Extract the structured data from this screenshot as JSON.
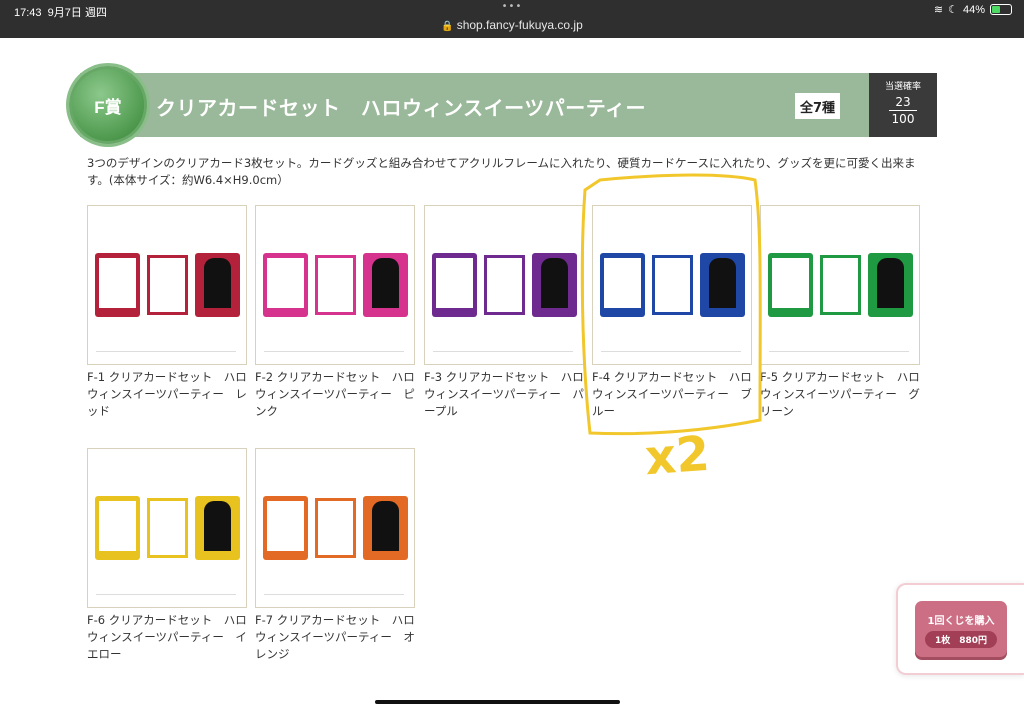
{
  "status": {
    "time": "17:43",
    "date": "9月7日 週四",
    "url": "shop.fancy-fukuya.co.jp",
    "battery_percent": "44%",
    "battery_level": 0.44,
    "dots": "•••"
  },
  "prize": {
    "rank": "F賞",
    "title": "クリアカードセット　ハロウィンスイーツパーティー",
    "variety": "全7種",
    "rate_label": "当選確率",
    "rate_numerator": "23",
    "rate_denominator": "100",
    "description": "3つのデザインのクリアカード3枚セット。カードグッズと組み合わせてアクリルフレームに入れたり、硬質カードケースに入れたり、グッズを更に可愛く出来ます。(本体サイズ：約W6.4×H9.0cm）"
  },
  "items": [
    {
      "caption": "F-1 クリアカードセット　ハロウィンスイーツパーティー　レッド",
      "color": "#b3223a"
    },
    {
      "caption": "F-2 クリアカードセット　ハロウィンスイーツパーティー　ピンク",
      "color": "#d6338f"
    },
    {
      "caption": "F-3 クリアカードセット　ハロウィンスイーツパーティー　パープル",
      "color": "#6e2a8e"
    },
    {
      "caption": "F-4 クリアカードセット　ハロウィンスイーツパーティー　ブルー",
      "color": "#1f47a6"
    },
    {
      "caption": "F-5 クリアカードセット　ハロウィンスイーツパーティー　グリーン",
      "color": "#1f9a42"
    },
    {
      "caption": "F-6 クリアカードセット　ハロウィンスイーツパーティー　イエロー",
      "color": "#e8c21e"
    },
    {
      "caption": "F-7 クリアカードセット　ハロウィンスイーツパーティー　オレンジ",
      "color": "#e36a25"
    }
  ],
  "annotation": {
    "text": "x2",
    "color": "#f1c72c"
  },
  "purchase": {
    "label": "1回くじを購入",
    "price": "1枚　880円"
  }
}
